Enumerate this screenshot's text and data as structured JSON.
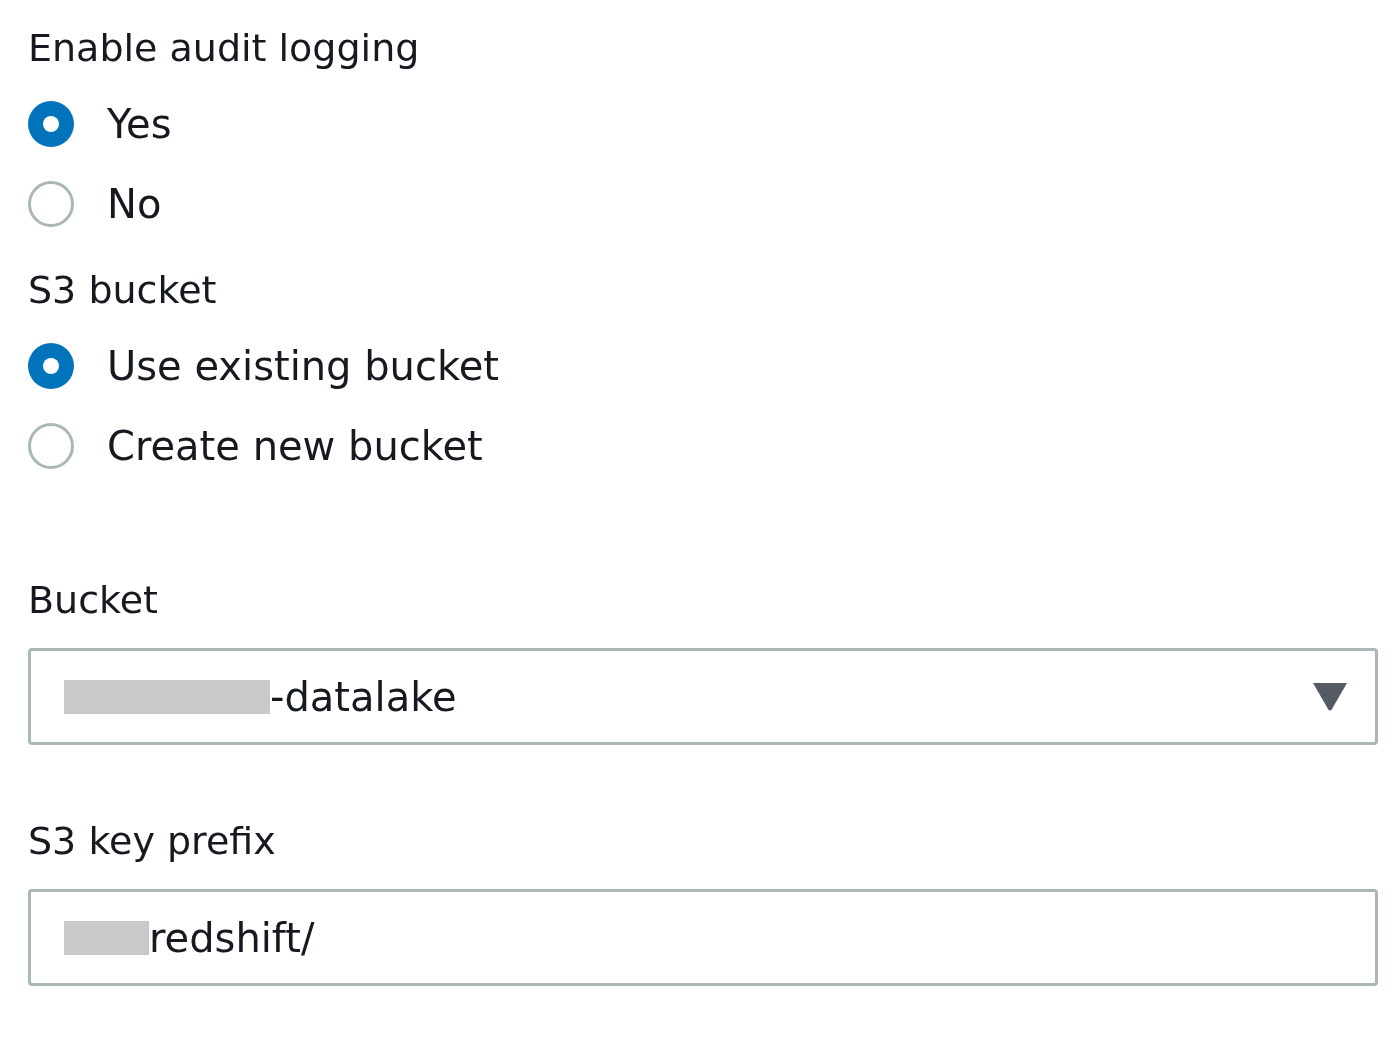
{
  "groups": [
    {
      "label": "Enable audit logging",
      "options": [
        {
          "label": "Yes",
          "selected": true
        },
        {
          "label": "No",
          "selected": false
        }
      ]
    },
    {
      "label": "S3 bucket",
      "options": [
        {
          "label": "Use existing bucket",
          "selected": true
        },
        {
          "label": "Create new bucket",
          "selected": false
        }
      ]
    }
  ],
  "fields": [
    {
      "kind": "select",
      "label": "Bucket",
      "value": "-datalake",
      "redacted": true
    },
    {
      "kind": "text",
      "label": "S3 key prefix",
      "value": "redshift/",
      "redacted": true
    }
  ]
}
